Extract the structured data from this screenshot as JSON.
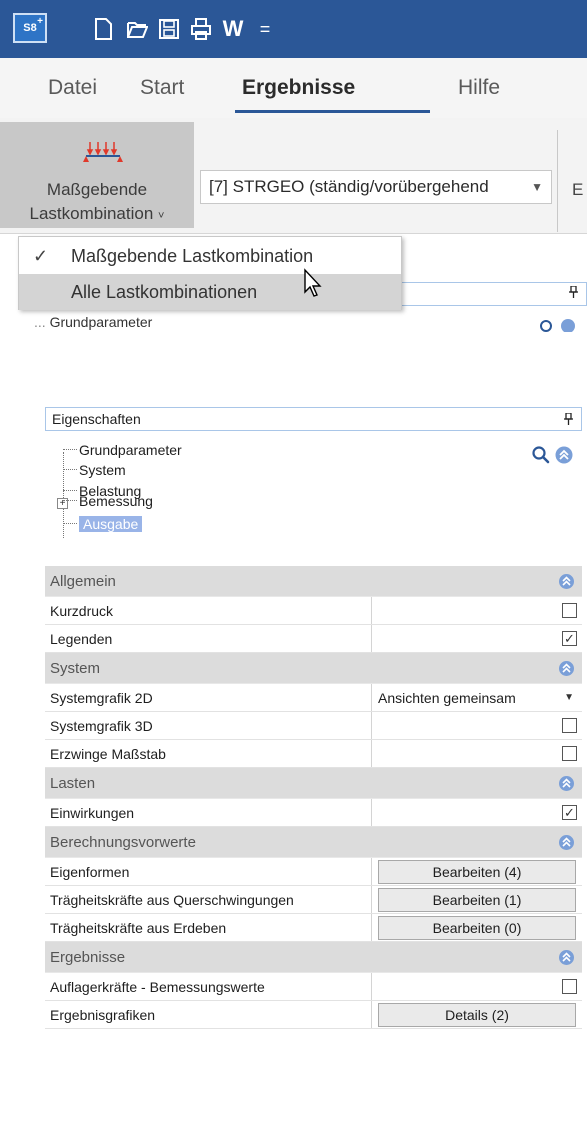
{
  "top": {
    "app_logo": "S8",
    "qat": {
      "icons": [
        "new-file-icon",
        "open-folder-icon",
        "save-icon",
        "print-icon",
        "word-export-icon",
        "customize-qat-icon"
      ],
      "w_label": "W",
      "more_label": "="
    },
    "tabs": [
      "Datei",
      "Start",
      "Ergebnisse",
      "Hilfe"
    ],
    "active_tab": "Ergebnisse",
    "ribbon": {
      "button_line1": "Maßgebende",
      "button_line2": "Lastkombination",
      "button_arrow": "˅",
      "combo_value": "[7] STRGEO (ständig/vorübergehend",
      "combo_arrow": "▼",
      "next_group_label": "E"
    },
    "dropdown": {
      "items": [
        {
          "label": "Maßgebende Lastkombination",
          "checked": true,
          "check": "✓"
        },
        {
          "label": "Alle Lastkombinationen",
          "checked": false,
          "hovered": true
        }
      ]
    },
    "pin": "𝆷",
    "truncated_tree_label": "Grundparameter"
  },
  "panel": {
    "title": "Eigenschaften",
    "pin": "ᑫ",
    "tree": [
      {
        "label": "Grundparameter"
      },
      {
        "label": "System"
      },
      {
        "label": "Belastung"
      },
      {
        "label": "Bemessung",
        "expandable": true,
        "expander": "+"
      },
      {
        "label": "Ausgabe",
        "selected": true
      }
    ]
  },
  "grid": {
    "allgemein": "Allgemein",
    "kurzdruck": "Kurzdruck",
    "kurzdruck_checked": "",
    "legenden": "Legenden",
    "legenden_checked": "✓",
    "system": "System",
    "systemgrafik_2d": "Systemgrafik 2D",
    "systemgrafik_2d_value": "Ansichten gemeinsam",
    "systemgrafik_3d": "Systemgrafik 3D",
    "systemgrafik_3d_checked": "",
    "erzwinge": "Erzwinge Maßstab",
    "erzwinge_checked": "",
    "lasten": "Lasten",
    "einwirkungen": "Einwirkungen",
    "einwirkungen_checked": "✓",
    "berechnungsvorwerte": "Berechnungsvorwerte",
    "eigenformen": "Eigenformen",
    "eigenformen_btn": "Bearbeiten (4)",
    "traeg_quer": "Trägheitskräfte aus Querschwingungen",
    "traeg_quer_btn": "Bearbeiten (1)",
    "traeg_erd": "Trägheitskräfte aus Erdeben",
    "traeg_erd_btn": "Bearbeiten (0)",
    "ergebnisse": "Ergebnisse",
    "auflager": "Auflagerkräfte - Bemessungswerte",
    "auflager_checked": "",
    "ergebnisgrafiken": "Ergebnisgrafiken",
    "ergebnisgrafiken_btn": "Details (2)"
  },
  "colors": {
    "titlebar": "#2b5797",
    "accent": "#2b5797",
    "selection": "#99b4e8",
    "category_bg": "#dcdcdc",
    "collapse_icon": "#7a9fd8"
  }
}
